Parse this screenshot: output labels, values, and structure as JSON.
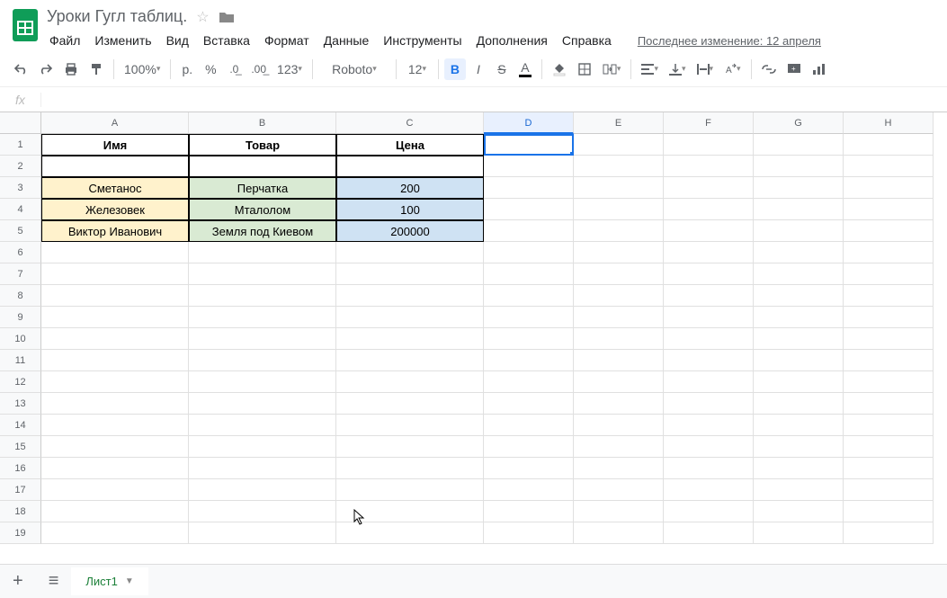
{
  "doc": {
    "title": "Уроки Гугл таблиц."
  },
  "menus": [
    "Файл",
    "Изменить",
    "Вид",
    "Вставка",
    "Формат",
    "Данные",
    "Инструменты",
    "Дополнения",
    "Справка"
  ],
  "last_edit": "Последнее изменение: 12 апреля",
  "toolbar": {
    "zoom": "100%",
    "currency": "р.",
    "pct": "%",
    "dec0": ".0",
    "dec00": ".00",
    "fmt": "123",
    "font": "Roboto",
    "size": "12"
  },
  "columns": [
    "A",
    "B",
    "C",
    "D",
    "E",
    "F",
    "G",
    "H"
  ],
  "headers": {
    "name": "Имя",
    "item": "Товар",
    "price": "Цена"
  },
  "rows": [
    {
      "name": "Сметанос",
      "item": "Перчатка",
      "price": "200"
    },
    {
      "name": "Железовек",
      "item": "Мталолом",
      "price": "100"
    },
    {
      "name": "Виктор Иванович",
      "item": "Земля под Киевом",
      "price": "200000"
    }
  ],
  "sheet_tab": "Лист1",
  "selected_cell": "D1"
}
